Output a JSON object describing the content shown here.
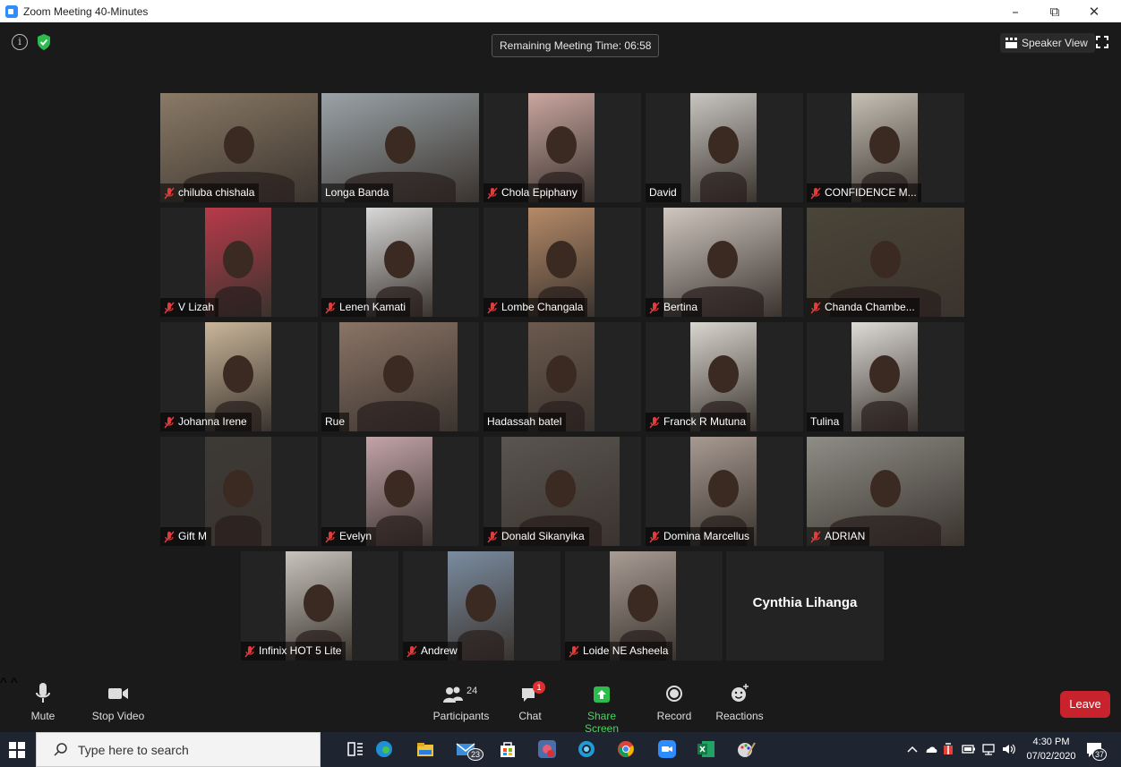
{
  "window": {
    "title": "Zoom Meeting 40-Minutes",
    "minimize_glyph": "–",
    "restore_glyph": "⧉",
    "close_glyph": "✕"
  },
  "meeting": {
    "remaining_time": "Remaining Meeting Time: 06:58",
    "speaker_view_label": "Speaker View",
    "info_glyph": "i"
  },
  "participants": [
    {
      "name": "chiluba chishala",
      "muted": true,
      "tone": "#8a7a66"
    },
    {
      "name": "Longa Banda",
      "muted": false,
      "active": true,
      "tone": "#9aa3a8"
    },
    {
      "name": "Chola Epiphany",
      "muted": true,
      "tone": "#caa6a0"
    },
    {
      "name": "David",
      "muted": false,
      "tone": "#c9c6c1"
    },
    {
      "name": "CONFIDENCE M...",
      "muted": true,
      "tone": "#c7c0b5"
    },
    {
      "name": "V Lizah",
      "muted": true,
      "tone": "#b83a4a"
    },
    {
      "name": "Lenen Kamati",
      "muted": true,
      "tone": "#d8d8d8"
    },
    {
      "name": "Lombe Changala",
      "muted": true,
      "tone": "#b58a68"
    },
    {
      "name": "Bertina",
      "muted": true,
      "tone": "#cfc6bf"
    },
    {
      "name": "Chanda Chambe...",
      "muted": true,
      "tone": "#4a4538"
    },
    {
      "name": "Johanna Irene",
      "muted": true,
      "tone": "#c9b69a"
    },
    {
      "name": "Rue",
      "muted": false,
      "tone": "#8a7466"
    },
    {
      "name": "Hadassah batel",
      "muted": false,
      "tone": "#6b5a4e"
    },
    {
      "name": "Franck R Mutuna",
      "muted": true,
      "tone": "#d9d6cf"
    },
    {
      "name": "Tulina",
      "muted": false,
      "tone": "#dedbd6"
    },
    {
      "name": "Gift M",
      "muted": true,
      "tone": "#3d3a36"
    },
    {
      "name": "Evelyn",
      "muted": true,
      "tone": "#c3a4a8"
    },
    {
      "name": "Donald Sikanyika",
      "muted": true,
      "tone": "#5a5550"
    },
    {
      "name": "Domina Marcellus",
      "muted": true,
      "tone": "#a79a92"
    },
    {
      "name": "ADRIAN",
      "muted": true,
      "tone": "#8e8d86"
    },
    {
      "name": "Infinix HOT 5 Lite",
      "muted": true,
      "tone": "#c8c4bd"
    },
    {
      "name": "Andrew",
      "muted": true,
      "tone": "#7a8ca0"
    },
    {
      "name": "Loide NE Asheela",
      "muted": true,
      "tone": "#a89c94"
    },
    {
      "name": "Cynthia Lihanga",
      "muted": false,
      "no_video": true
    }
  ],
  "controls": {
    "mute_label": "Mute",
    "stop_video_label": "Stop Video",
    "participants_label": "Participants",
    "participants_count": "24",
    "chat_label": "Chat",
    "chat_badge": "1",
    "share_screen_label": "Share Screen",
    "record_label": "Record",
    "reactions_label": "Reactions",
    "leave_label": "Leave",
    "caret_glyph": "^"
  },
  "taskbar": {
    "search_placeholder": "Type here to search",
    "mail_badge": "23",
    "time": "4:30 PM",
    "date": "07/02/2020",
    "notification_count": "37"
  },
  "colors": {
    "meeting_bg": "#1a1a1a",
    "active_speaker": "#a6d94c",
    "share_green": "#4cd164",
    "leave_red": "#c8232c",
    "muted_red": "#e03c3c",
    "taskbar_bg": "#1e2430"
  }
}
